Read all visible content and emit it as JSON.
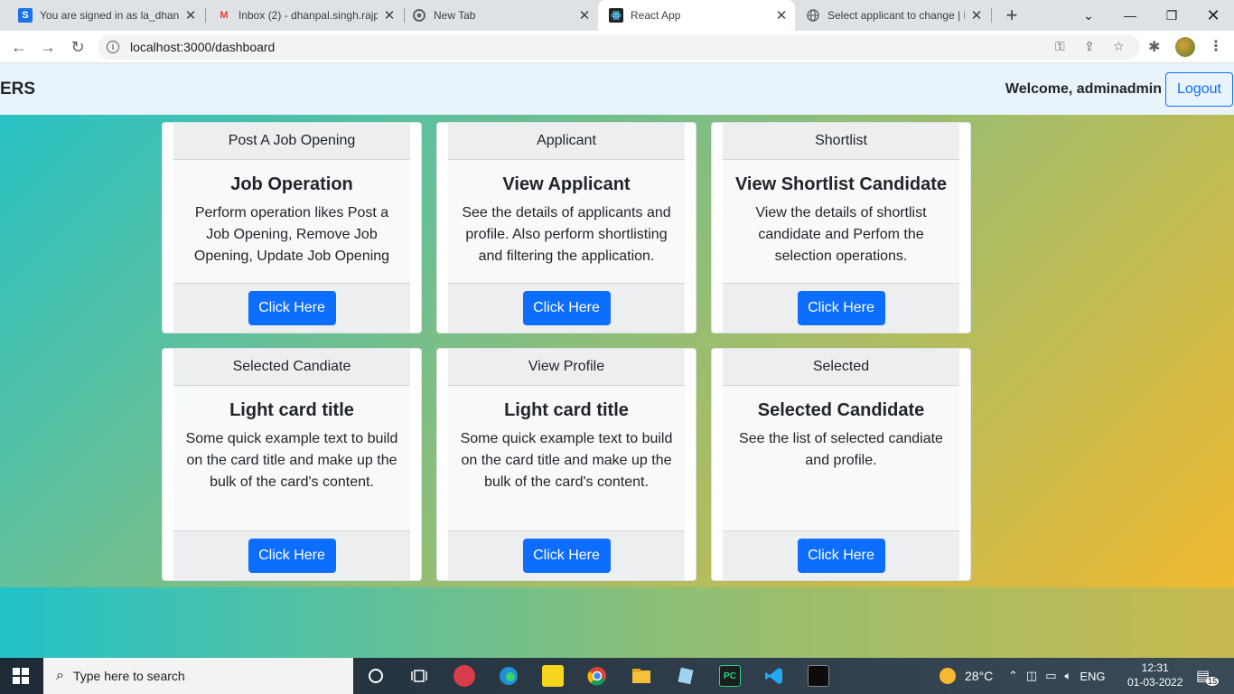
{
  "browser": {
    "tabs": [
      {
        "title": "You are signed in as la_dhanp",
        "favicon": "S",
        "favicon_color": "#1a73e8",
        "active": false
      },
      {
        "title": "Inbox (2) - dhanpal.singh.rajp",
        "favicon": "M",
        "favicon_color": "#ea4335",
        "active": false
      },
      {
        "title": "New Tab",
        "favicon": "chrome-icon",
        "favicon_color": "#5f6368",
        "active": false
      },
      {
        "title": "React App",
        "favicon": "react-icon",
        "favicon_color": "#61dafb",
        "active": true
      },
      {
        "title": "Select applicant to change | D",
        "favicon": "globe-icon",
        "favicon_color": "#5f6368",
        "active": false
      }
    ],
    "url": "localhost:3000/dashboard"
  },
  "app": {
    "brand": "ERS",
    "welcome": "Welcome, adminadmin",
    "logout_label": "Logout"
  },
  "cards": [
    {
      "header": "Post A Job Opening",
      "title": "Job Operation",
      "text": "Perform operation likes Post a Job Opening, Remove Job Opening, Update Job Opening",
      "button": "Click Here"
    },
    {
      "header": "Applicant",
      "title": "View Applicant",
      "text": "See the details of applicants and profile. Also perform shortlisting and filtering the application.",
      "button": "Click Here"
    },
    {
      "header": "Shortlist",
      "title": "View Shortlist Candidate",
      "text": "View the details of shortlist candidate and Perfom the selection operations.",
      "button": "Click Here"
    },
    {
      "header": "Selected Candiate",
      "title": "Light card title",
      "text": "Some quick example text to build on the card title and make up the bulk of the card's content.",
      "button": "Click Here"
    },
    {
      "header": "View Profile",
      "title": "Light card title",
      "text": "Some quick example text to build on the card title and make up the bulk of the card's content.",
      "button": "Click Here"
    },
    {
      "header": "Selected",
      "title": "Selected Candidate",
      "text": "See the list of selected candiate and profile.",
      "button": "Click Here"
    }
  ],
  "taskbar": {
    "search_placeholder": "Type here to search",
    "weather": "28°C",
    "language": "ENG",
    "time": "12:31",
    "date": "01-03-2022",
    "notifications": "15"
  },
  "colors": {
    "primary": "#0d6efd",
    "gradient_start": "#22c2c9",
    "gradient_end": "#f8b92b"
  }
}
